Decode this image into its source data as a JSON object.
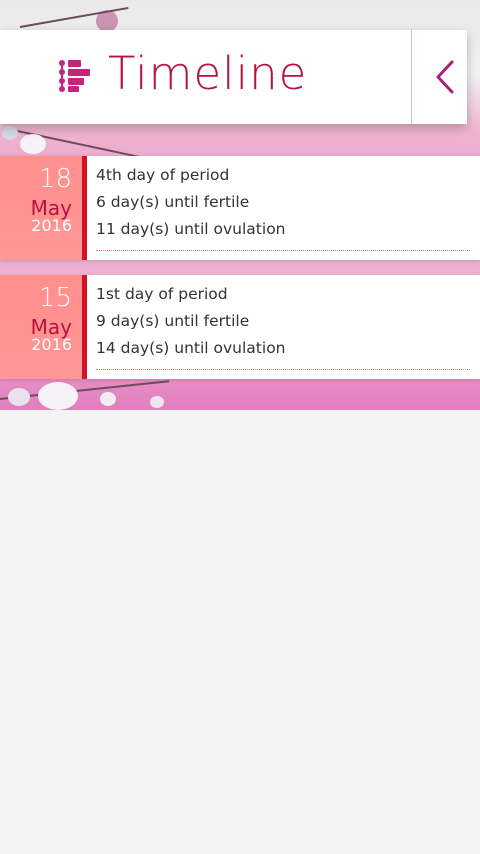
{
  "header": {
    "title": "Timeline",
    "menu_icon": "timeline-list-icon",
    "back_icon": "chevron-left-icon"
  },
  "colors": {
    "accent": "#b5123d",
    "date_block": "#ff8f8c",
    "date_border": "#d01328",
    "background_pink": "#e59ac3"
  },
  "entries": [
    {
      "day": "18",
      "month": "May",
      "year": "2016",
      "lines": [
        "4th day of period",
        "6 day(s) until fertile",
        "11 day(s) until ovulation"
      ]
    },
    {
      "day": "15",
      "month": "May",
      "year": "2016",
      "lines": [
        "1st day of period",
        "9 day(s) until fertile",
        "14 day(s) until ovulation"
      ]
    }
  ]
}
